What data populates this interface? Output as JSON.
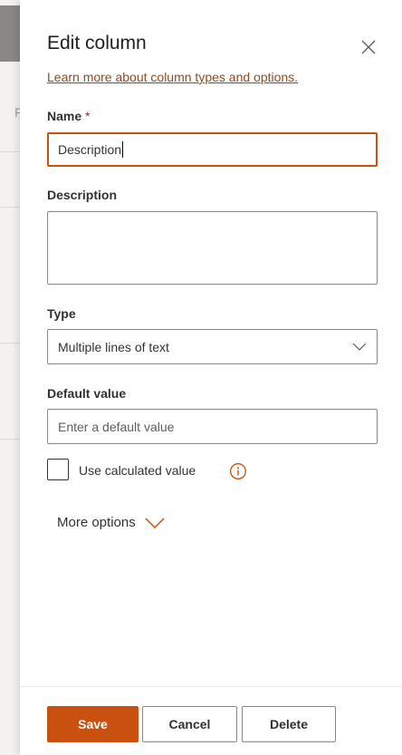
{
  "panel": {
    "title": "Edit column",
    "learn_link": "Learn more about column types and options."
  },
  "background": {
    "letter": "F"
  },
  "name_field": {
    "label": "Name",
    "required_mark": "*",
    "value": "Description"
  },
  "description_field": {
    "label": "Description",
    "value": ""
  },
  "type_field": {
    "label": "Type",
    "selected": "Multiple lines of text"
  },
  "default_field": {
    "label": "Default value",
    "placeholder": "Enter a default value"
  },
  "calculated": {
    "label": "Use calculated value",
    "checked": false
  },
  "more_options": {
    "label": "More options"
  },
  "buttons": {
    "save": "Save",
    "cancel": "Cancel",
    "delete": "Delete"
  },
  "colors": {
    "accent": "#ca5010",
    "link": "#8e4b1d"
  },
  "icons": {
    "close": "close-icon",
    "dropdown": "chevron-down-icon",
    "info": "info-icon",
    "more": "chevron-down-icon"
  }
}
